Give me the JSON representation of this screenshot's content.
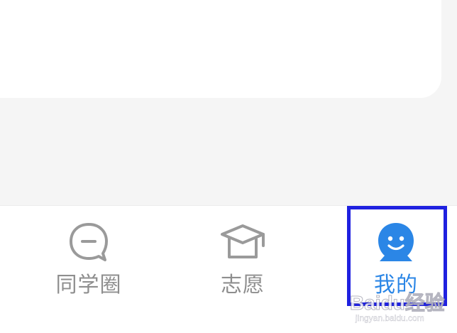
{
  "bottom_nav": {
    "items": [
      {
        "label": "同学圈",
        "icon": "chat-bubble-icon",
        "active": false
      },
      {
        "label": "志愿",
        "icon": "graduation-cap-icon",
        "active": false
      },
      {
        "label": "我的",
        "icon": "smiley-face-icon",
        "active": true
      }
    ]
  },
  "colors": {
    "active": "#2b86e6",
    "inactive": "#8e8e8e",
    "highlight_border": "#1f21e0",
    "page_background": "#f5f5f5"
  },
  "watermark": {
    "logo_text": "Baidu经验",
    "url": "jingyan.baidu.com"
  }
}
